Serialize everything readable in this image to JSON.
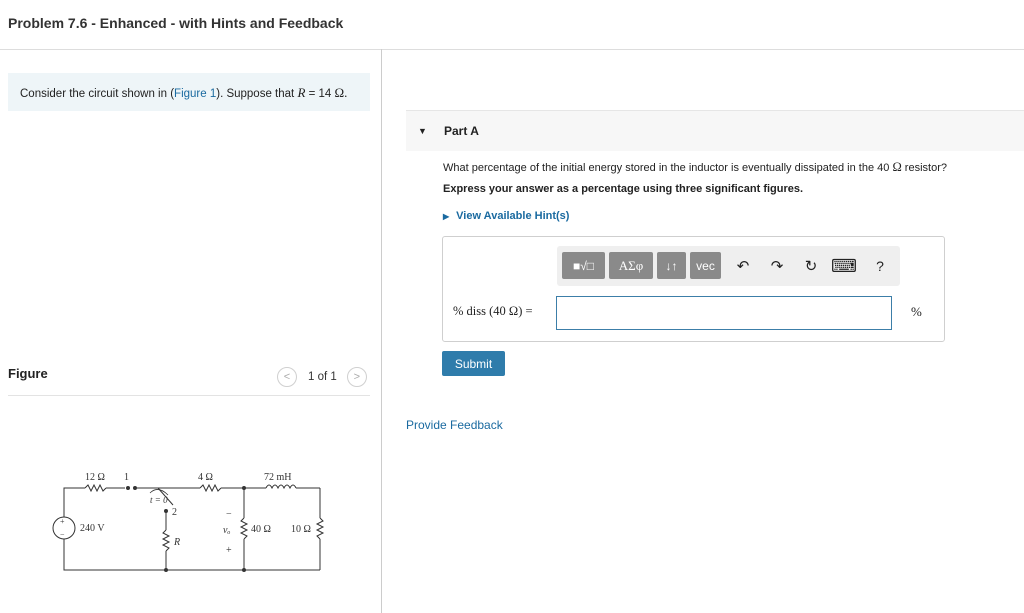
{
  "problem_title": "Problem 7.6 - Enhanced - with Hints and Feedback",
  "intro": {
    "before_link": "Consider the circuit shown in (",
    "link": "Figure 1",
    "after_link": "). Suppose that ",
    "var": "R",
    "equals": " = 14 ",
    "unit": "Ω."
  },
  "figure": {
    "label": "Figure",
    "pager_text": "1 of 1",
    "prev_glyph": "<",
    "next_glyph": ">",
    "circuit_labels": {
      "r12": "12 Ω",
      "node1": "1",
      "t0": "t = 0",
      "node2": "2",
      "r4": "4 Ω",
      "l72": "72 mH",
      "source": "240 V",
      "r_var": "R",
      "minus": "−",
      "vo": "vₒ",
      "plus": "+",
      "r40": "40 Ω",
      "r10": "10 Ω",
      "src_plus": "+",
      "src_minus": "−"
    }
  },
  "part": {
    "toggle_glyph": "▼",
    "title": "Part A",
    "question_before": "What percentage of the initial energy stored in the inductor is eventually dissipated in the 40 ",
    "question_unit": "Ω",
    "question_after": " resistor?",
    "instruction": "Express your answer as a percentage using three significant figures.",
    "hint_glyph": "▶",
    "hint_label": "View Available Hint(s)",
    "toolbar": {
      "templates": "■√□",
      "symbols": "ΑΣφ",
      "arrows": "↓↑",
      "vec": "vec",
      "undo": "↶",
      "redo": "↷",
      "reset": "↻",
      "keyboard": "⌨",
      "help": "?"
    },
    "answer_label": "% diss (40 Ω) =",
    "answer_value": "",
    "answer_unit": "%",
    "submit_label": "Submit"
  },
  "feedback_label": "Provide Feedback"
}
